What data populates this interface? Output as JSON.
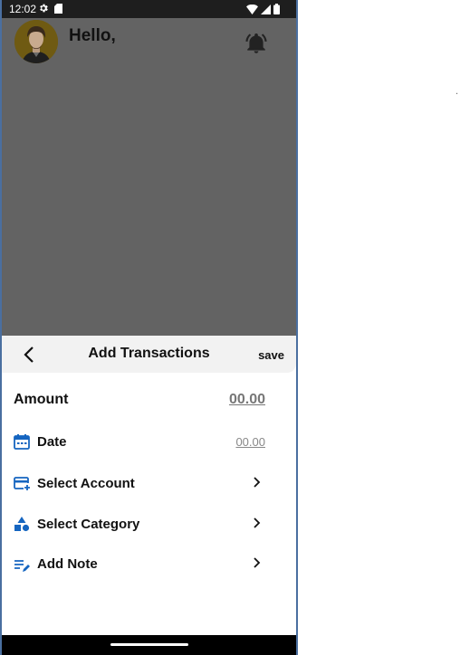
{
  "status_bar": {
    "time": "12:02",
    "icons": [
      "gear-icon",
      "sd-card-icon",
      "wifi-icon",
      "signal-icon",
      "battery-icon"
    ]
  },
  "home": {
    "greeting": "Hello,",
    "icons": [
      "avatar",
      "bell-icon"
    ]
  },
  "sheet": {
    "title": "Add Transactions",
    "save_label": "save",
    "amount_label": "Amount",
    "amount_value": "00.00",
    "date_label": "Date",
    "date_value": "00.00",
    "select_account_label": "Select Account",
    "select_category_label": "Select Category",
    "add_note_label": "Add Note"
  },
  "colors": {
    "accent_blue": "#1565c0",
    "overlay": "#636363",
    "status_bar": "#1e1e1e",
    "header_bg": "#f2f2f2"
  }
}
